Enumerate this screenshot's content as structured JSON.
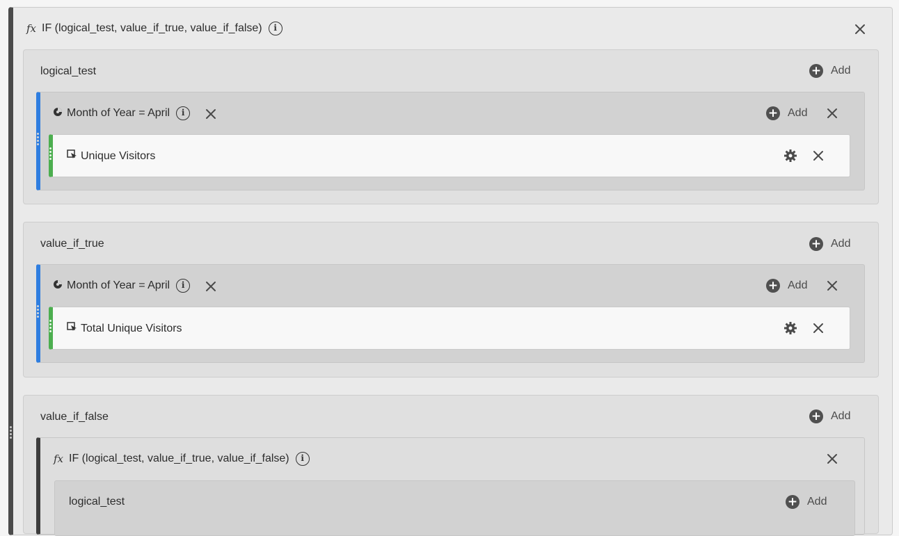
{
  "outer_function": {
    "fx_symbol": "fx",
    "signature": "IF (logical_test, value_if_true, value_if_false)",
    "close_icon": "close-icon",
    "info_icon": "info-icon"
  },
  "arguments": [
    {
      "name": "logical_test",
      "add_label": "Add",
      "segment": {
        "label": "Month of Year = April",
        "metric": {
          "label": "Unique Visitors"
        }
      }
    },
    {
      "name": "value_if_true",
      "add_label": "Add",
      "segment": {
        "label": "Month of Year = April",
        "metric": {
          "label": "Total Unique Visitors"
        }
      }
    },
    {
      "name": "value_if_false",
      "add_label": "Add",
      "nested_function": {
        "fx_symbol": "fx",
        "signature": "IF (logical_test, value_if_true, value_if_false)",
        "arguments": [
          {
            "name": "logical_test",
            "add_label": "Add"
          }
        ]
      }
    }
  ],
  "colors": {
    "segment_accent": "#2f7ee0",
    "metric_accent": "#4cae4f",
    "function_accent": "#4b4b4b"
  }
}
